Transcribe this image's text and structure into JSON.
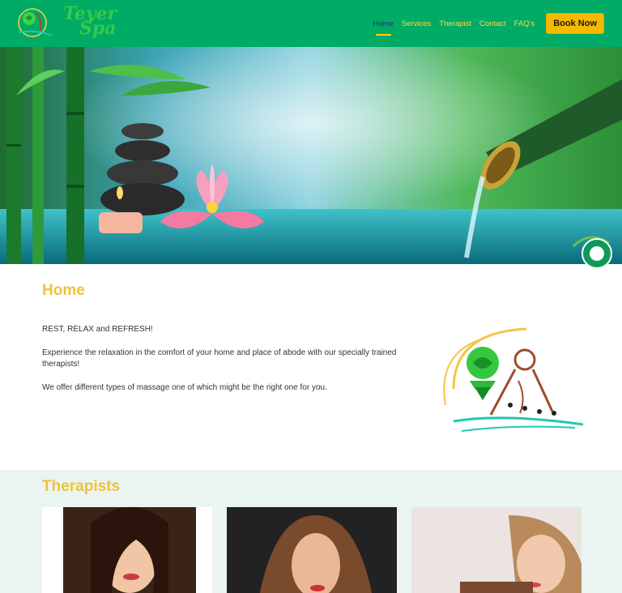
{
  "brand": {
    "logo_line1": "Teyer",
    "logo_line2": "Spa",
    "primary_color": "#00ab66",
    "accent_color": "#f5b900",
    "heading_color": "#f0c23a"
  },
  "nav": {
    "items": [
      {
        "label": "Home",
        "active": true
      },
      {
        "label": "Services",
        "active": false
      },
      {
        "label": "Therapist",
        "active": false
      },
      {
        "label": "Contact",
        "active": false
      },
      {
        "label": "FAQ's",
        "active": false
      }
    ],
    "cta_label": "Book Now"
  },
  "home": {
    "title": "Home",
    "paragraphs": [
      "REST, RELAX and REFRESH!",
      "Experience the relaxation in the comfort of your home and place of abode with our specially trained therapists!",
      "We offer different types of massage one of which might be the right one for you."
    ]
  },
  "therapists": {
    "title": "Therapists",
    "cards": [
      {
        "icon": "therapist-photo-1"
      },
      {
        "icon": "therapist-photo-2"
      },
      {
        "icon": "therapist-photo-3"
      }
    ]
  },
  "chat": {
    "icon": "chat-icon"
  }
}
